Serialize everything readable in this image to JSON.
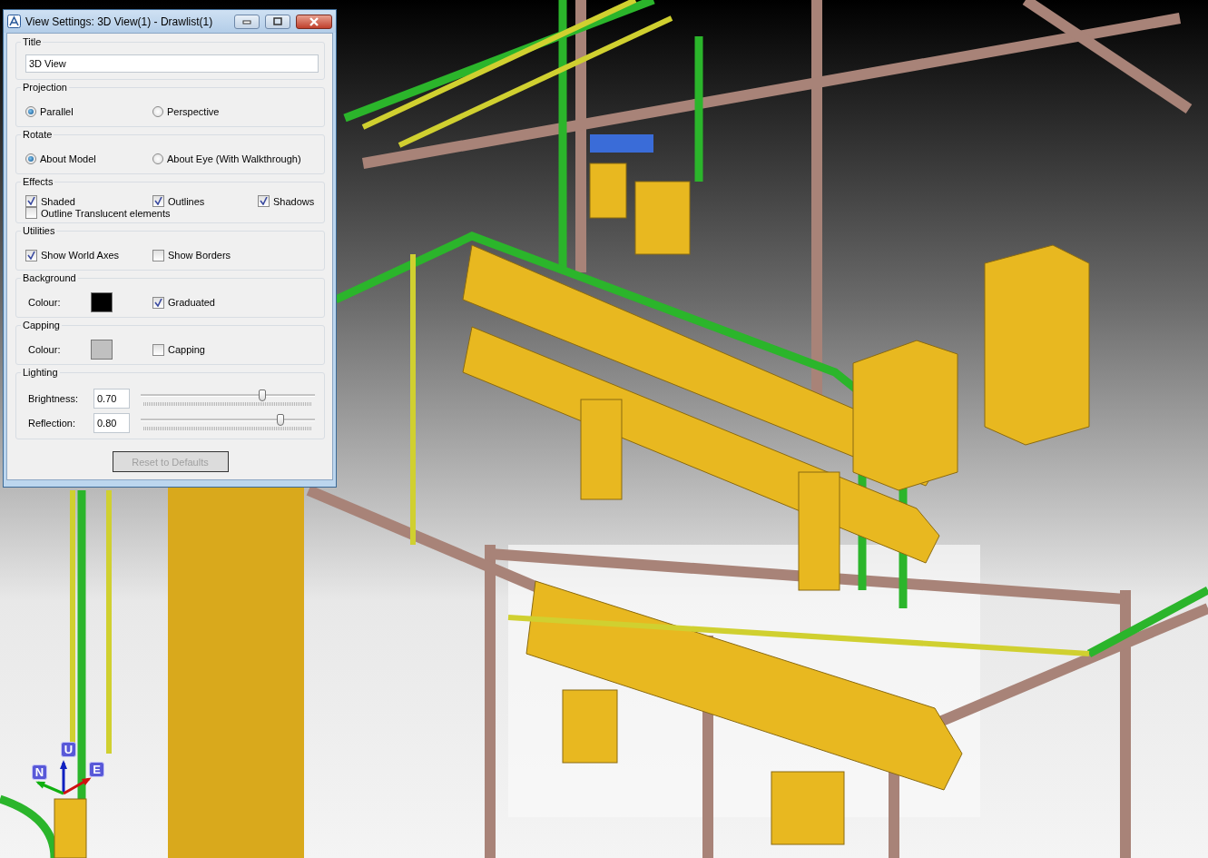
{
  "window": {
    "title": "View Settings: 3D View(1) - Drawlist(1)"
  },
  "sections": [
    {
      "kind": "text",
      "label": "Title",
      "value": "3D View"
    },
    {
      "kind": "radio",
      "label": "Projection",
      "options": [
        {
          "label": "Parallel",
          "selected": true
        },
        {
          "label": "Perspective",
          "selected": false
        }
      ]
    },
    {
      "kind": "radio",
      "label": "Rotate",
      "options": [
        {
          "label": "About Model",
          "selected": true
        },
        {
          "label": "About Eye (With Walkthrough)",
          "selected": false
        }
      ]
    },
    {
      "kind": "checks",
      "label": "Effects",
      "items": [
        {
          "label": "Shaded",
          "checked": true
        },
        {
          "label": "Outlines",
          "checked": true
        },
        {
          "label": "Shadows",
          "checked": true
        },
        {
          "label": "Outline Translucent elements",
          "checked": false
        }
      ]
    },
    {
      "kind": "checks",
      "label": "Utilities",
      "items": [
        {
          "label": "Show World Axes",
          "checked": true
        },
        {
          "label": "Show Borders",
          "checked": false
        }
      ]
    },
    {
      "kind": "colour",
      "label": "Background",
      "colour_label": "Colour:",
      "color": "#000000",
      "option": {
        "label": "Graduated",
        "checked": true
      }
    },
    {
      "kind": "colour",
      "label": "Capping",
      "colour_label": "Colour:",
      "color": "#c0c0c0",
      "option": {
        "label": "Capping",
        "checked": false
      }
    },
    {
      "kind": "sliders",
      "label": "Lighting",
      "items": [
        {
          "label": "Brightness:",
          "value": "0.70",
          "level": 0.7
        },
        {
          "label": "Reflection:",
          "value": "0.80",
          "level": 0.8
        }
      ]
    }
  ],
  "reset_button": {
    "label": "Reset to Defaults",
    "disabled": true
  },
  "axes": [
    {
      "label": "U",
      "color": "#1020c0"
    },
    {
      "label": "N",
      "color": "#10b010"
    },
    {
      "label": "E",
      "color": "#d01010"
    }
  ]
}
